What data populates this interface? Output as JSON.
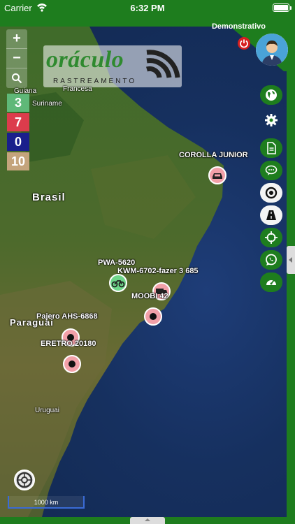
{
  "status_bar": {
    "carrier": "Carrier",
    "time": "6:32 PM"
  },
  "logo": {
    "brand": "oráculo",
    "subtitle": "RASTREAMENTO"
  },
  "user": {
    "name": "Demonstrativo"
  },
  "zoom": {
    "in": "+",
    "out": "−"
  },
  "counters": [
    {
      "value": "3",
      "color": "#5fb878"
    },
    {
      "value": "7",
      "color": "#dc3c4c"
    },
    {
      "value": "0",
      "color": "#1a1f8c"
    },
    {
      "value": "10",
      "color": "#c4a47c"
    }
  ],
  "map_labels": {
    "guiana": "Guiana",
    "francesa": "Francesa",
    "suriname": "Suriname",
    "brasil": "Brasil",
    "paraguai": "Paraguai",
    "uruguai": "Uruguai"
  },
  "vehicles": [
    {
      "label": "COROLLA JUNIOR",
      "icon": "car-icon",
      "color": "#f2a0a8"
    },
    {
      "label": "PWA-5620",
      "icon": "motorcycle-icon",
      "color": "#6ed68a"
    },
    {
      "label": "KWM-6702-fazer 3 685",
      "icon": "truck-icon",
      "color": "#f2a0a8"
    },
    {
      "label": "MOOBI 42",
      "icon": "stopped-icon",
      "color": "#f2a0a8"
    },
    {
      "label": "Pajero AHS-6868",
      "icon": "stopped-icon",
      "color": "#f2a0a8"
    },
    {
      "label": "ERETRO 20180",
      "icon": "stopped-icon",
      "color": "#f2a0a8"
    }
  ],
  "right_buttons": [
    "globe-icon",
    "gear-icon",
    "document-icon",
    "chat-icon",
    "target-icon",
    "road-icon",
    "crosshair-icon",
    "whatsapp-icon",
    "speedometer-icon"
  ],
  "scale": {
    "label": "1000 km"
  },
  "colors": {
    "brand_green": "#1e7d1e",
    "map_ocean": "#16305f"
  }
}
